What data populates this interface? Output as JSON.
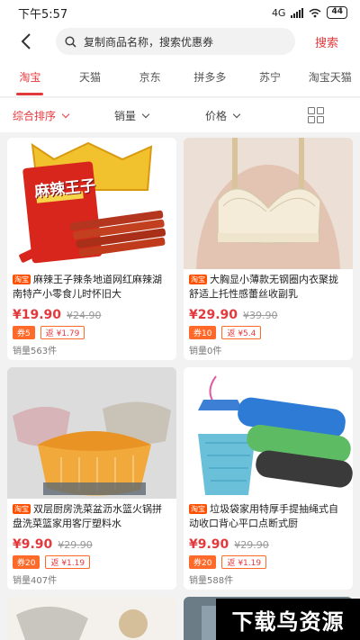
{
  "status": {
    "time": "下午5:57",
    "network": "4G",
    "battery": "44"
  },
  "search": {
    "value": "复制商品名称，搜索优惠券",
    "button_label": "搜索"
  },
  "tabs": [
    {
      "label": "淘宝"
    },
    {
      "label": "天猫"
    },
    {
      "label": "京东"
    },
    {
      "label": "拼多多"
    },
    {
      "label": "苏宁"
    },
    {
      "label": "淘宝天猫"
    }
  ],
  "sort": {
    "default_label": "综合排序",
    "sales_label": "销量",
    "price_label": "价格"
  },
  "products": [
    {
      "tag": "淘宝",
      "title": "麻辣王子辣条地道网红麻辣湖南特产小零食儿时怀旧大",
      "price": "¥19.90",
      "original": "¥24.90",
      "coupon": "券5",
      "rebate": "返 ¥1.79",
      "sales": "销量563件",
      "image_label": "麻辣王子"
    },
    {
      "tag": "淘宝",
      "title": "大胸显小薄款无钢圈内衣聚拢舒适上托性感蕾丝收副乳",
      "price": "¥29.90",
      "original": "¥39.90",
      "coupon": "券10",
      "rebate": "返 ¥5.4",
      "sales": "销量0件"
    },
    {
      "tag": "淘宝",
      "title": "双层厨房洗菜盆沥水篮火锅拼盘洗菜篮家用客厅塑料水",
      "price": "¥9.90",
      "original": "¥29.90",
      "coupon": "券20",
      "rebate": "返 ¥1.19",
      "sales": "销量407件"
    },
    {
      "tag": "淘宝",
      "title": "垃圾袋家用特厚手提抽绳式自动收口背心平口点断式厨",
      "price": "¥9.90",
      "original": "¥29.90",
      "coupon": "券20",
      "rebate": "返 ¥1.19",
      "sales": "销量588件"
    }
  ],
  "watermark": "下载鸟资源",
  "colors": {
    "accent": "#e4393c",
    "coupon": "#ff6a2b",
    "tag": "#ff5000"
  }
}
